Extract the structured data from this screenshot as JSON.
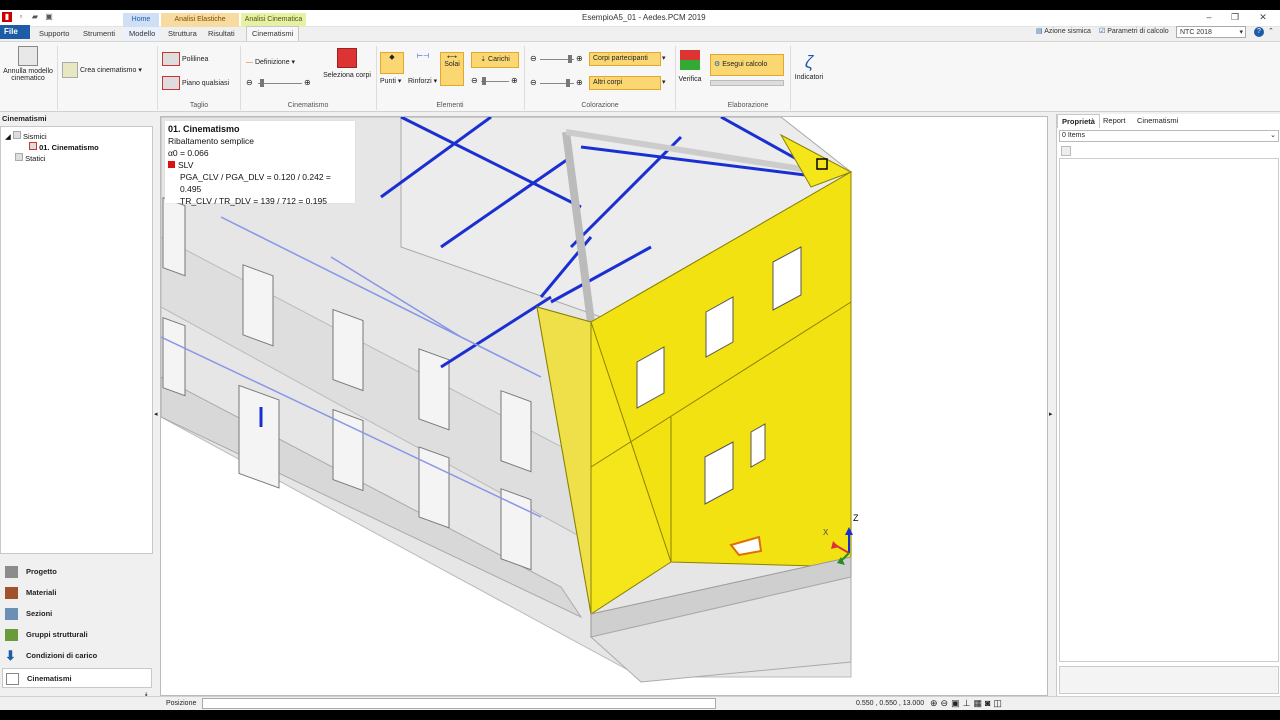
{
  "window": {
    "title": "EsempioA5_01 - Aedes.PCM 2019"
  },
  "context_groups": {
    "home": "Home",
    "elastic": "Analisi Elastiche",
    "kinematic": "Analisi Cinematica"
  },
  "tabs": {
    "file": "File",
    "supporto": "Supporto",
    "strumenti": "Strumenti",
    "modello": "Modello",
    "struttura": "Struttura",
    "risultati": "Risultati",
    "cinematismi": "Cinematismi"
  },
  "header_right": {
    "azione": "Azione sismica",
    "parametri": "Parametri di calcolo",
    "norma": "NTC 2018"
  },
  "ribbon": {
    "annulla": "Annulla modello cinematico",
    "crea": "Crea cinematismo",
    "polilinea": "Polilinea",
    "piano": "Piano qualsiasi",
    "taglio": "Taglio",
    "definizione": "Definizione",
    "group_cinematismo": "Cinematismo",
    "seleziona": "Seleziona corpi",
    "punti": "Punti",
    "rinforzi": "Rinforzi",
    "solai": "Solai",
    "carichi": "Carichi",
    "group_elementi": "Elementi",
    "corpi": "Corpi partecipanti",
    "altri": "Altri corpi",
    "group_colorazione": "Colorazione",
    "verifica": "Verifica",
    "esegui": "Esegui calcolo",
    "group_elaborazione": "Elaborazione",
    "indicatori": "Indicatori"
  },
  "left_panel": {
    "title": "Cinematismi",
    "tree": {
      "sismici": "Sismici",
      "item": "01. Cinematismo",
      "statici": "Statici"
    },
    "nav": [
      "Progetto",
      "Materiali",
      "Sezioni",
      "Gruppi strutturali",
      "Condizioni di carico",
      "Cinematismi"
    ]
  },
  "infobox": {
    "title": "01. Cinematismo",
    "type": "Ribaltamento semplice",
    "alpha": "α0 = 0.066",
    "slv": "SLV",
    "pga": "PGA_CLV / PGA_DLV = 0.120 / 0.242 = 0.495",
    "tr": "TR_CLV / TR_DLV = 139 / 712 = 0.195"
  },
  "right_panel": {
    "tabs": [
      "Proprietà",
      "Report",
      "Cinematismi"
    ],
    "items": "0 Items"
  },
  "status": {
    "label": "Posizione",
    "coords": "0.550 , 0.550 , 13.000"
  },
  "axis": {
    "z": "Z",
    "x": "X"
  },
  "colors": {
    "accent": "#1e5ca8",
    "highlight": "#f5e61b",
    "contour": "#1a2fd1"
  }
}
